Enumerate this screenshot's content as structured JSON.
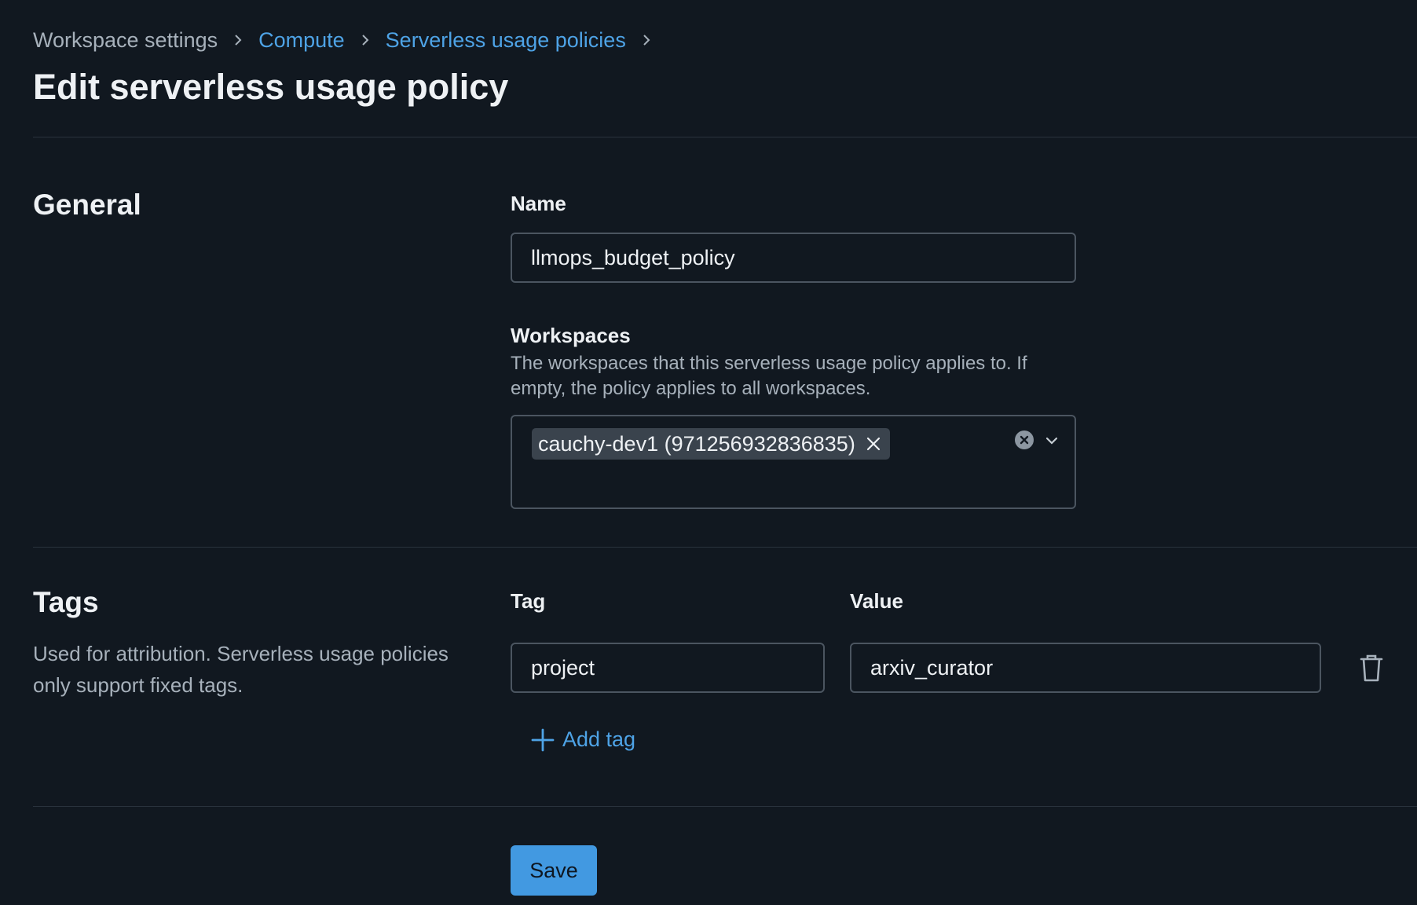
{
  "breadcrumb": {
    "items": [
      {
        "label": "Workspace settings"
      },
      {
        "label": "Compute"
      },
      {
        "label": "Serverless usage policies"
      }
    ]
  },
  "page": {
    "title": "Edit serverless usage policy"
  },
  "general": {
    "title": "General",
    "name_label": "Name",
    "name_value": "llmops_budget_policy",
    "workspaces_label": "Workspaces",
    "workspaces_description_line1": "The workspaces that this serverless usage policy applies to. If",
    "workspaces_description_line2": "empty, the policy applies to all workspaces.",
    "selected_workspaces": [
      "cauchy-dev1 (971256932836835)"
    ]
  },
  "tags": {
    "title": "Tags",
    "description_line1": "Used for attribution. Serverless usage policies",
    "description_line2": "only support fixed tags.",
    "tag_header": "Tag",
    "value_header": "Value",
    "rows": [
      {
        "tag": "project",
        "value": "arxiv_curator"
      }
    ],
    "add_label": "Add tag"
  },
  "actions": {
    "save_label": "Save"
  },
  "colors": {
    "background": "#111820",
    "link": "#4ea3e6",
    "primary_button": "#4299e1",
    "border": "#4b5560"
  },
  "icons": {
    "breadcrumb_separator": "chevron-right-icon",
    "chip_remove": "close-icon",
    "clear_all": "clear-circle-icon",
    "dropdown": "chevron-down-icon",
    "delete": "trash-icon",
    "add": "plus-icon"
  }
}
